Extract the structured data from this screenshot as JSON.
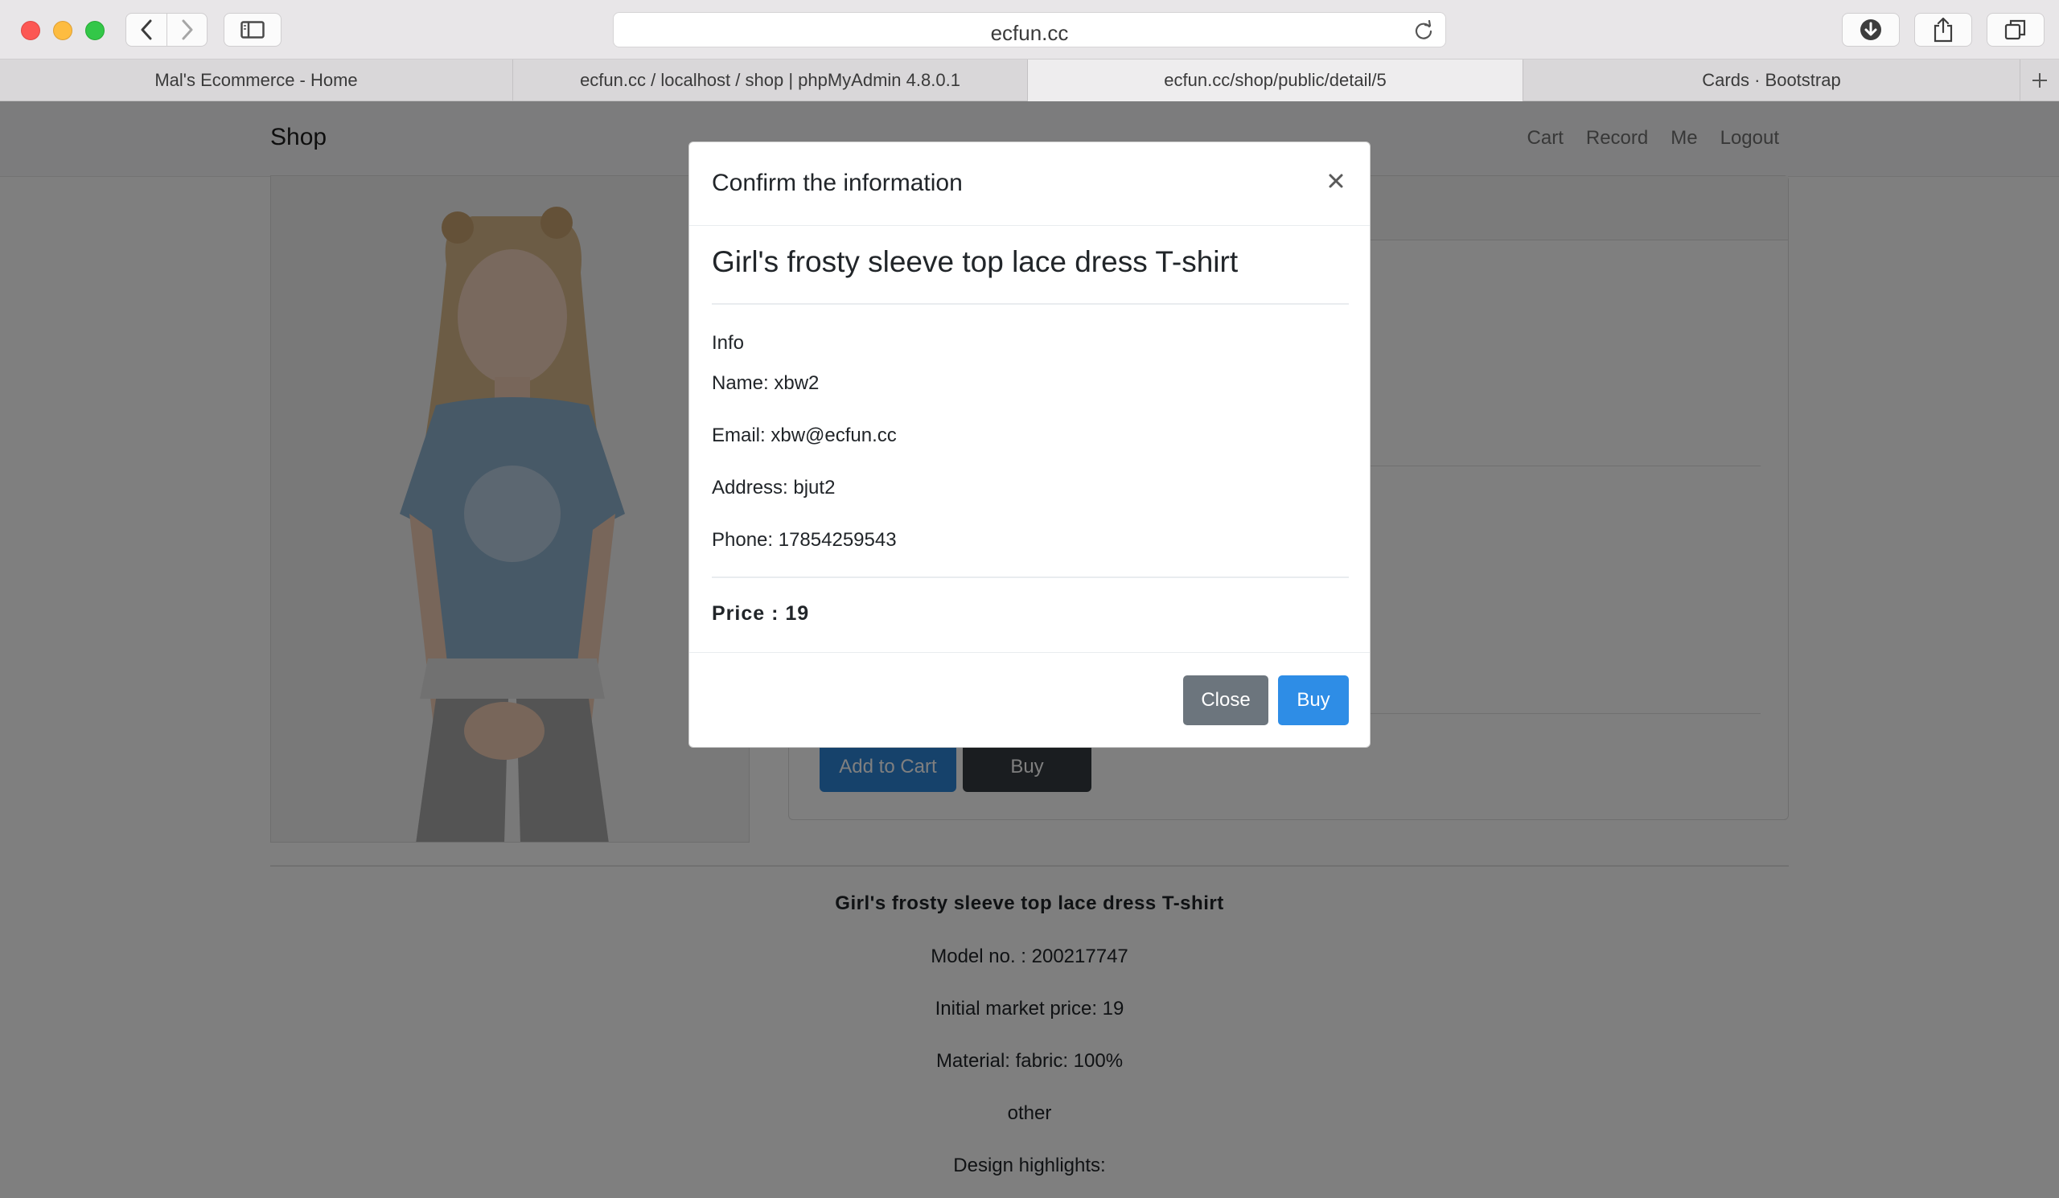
{
  "browser": {
    "url": "ecfun.cc",
    "tabs": [
      {
        "title": "Mal's Ecommerce - Home",
        "active": false
      },
      {
        "title": "ecfun.cc / localhost / shop | phpMyAdmin 4.8.0.1",
        "active": false
      },
      {
        "title": "ecfun.cc/shop/public/detail/5",
        "active": true
      },
      {
        "title": "Cards · Bootstrap",
        "active": false
      }
    ]
  },
  "navbar": {
    "brand": "Shop",
    "links": [
      "Cart",
      "Record",
      "Me",
      "Logout"
    ]
  },
  "product_page": {
    "add_to_cart_label": "Add to Cart",
    "buy_label": "Buy",
    "description": {
      "title": "Girl's frosty sleeve top lace dress T-shirt",
      "model": "Model no. : 200217747",
      "market_price": "Initial market price: 19",
      "material": "Material: fabric: 100%",
      "other": "other",
      "highlights": "Design highlights:"
    }
  },
  "modal": {
    "title": "Confirm the information",
    "product_name": "Girl's frosty sleeve top lace dress T-shirt",
    "info_heading": "Info",
    "name": "Name: xbw2",
    "email": "Email: xbw@ecfun.cc",
    "address": "Address: bjut2",
    "phone": "Phone: 17854259543",
    "price": "Price : 19",
    "close_label": "Close",
    "buy_label": "Buy"
  },
  "colors": {
    "primary": "#2e8de6",
    "secondary": "#6c757d",
    "dark": "#343a40"
  }
}
